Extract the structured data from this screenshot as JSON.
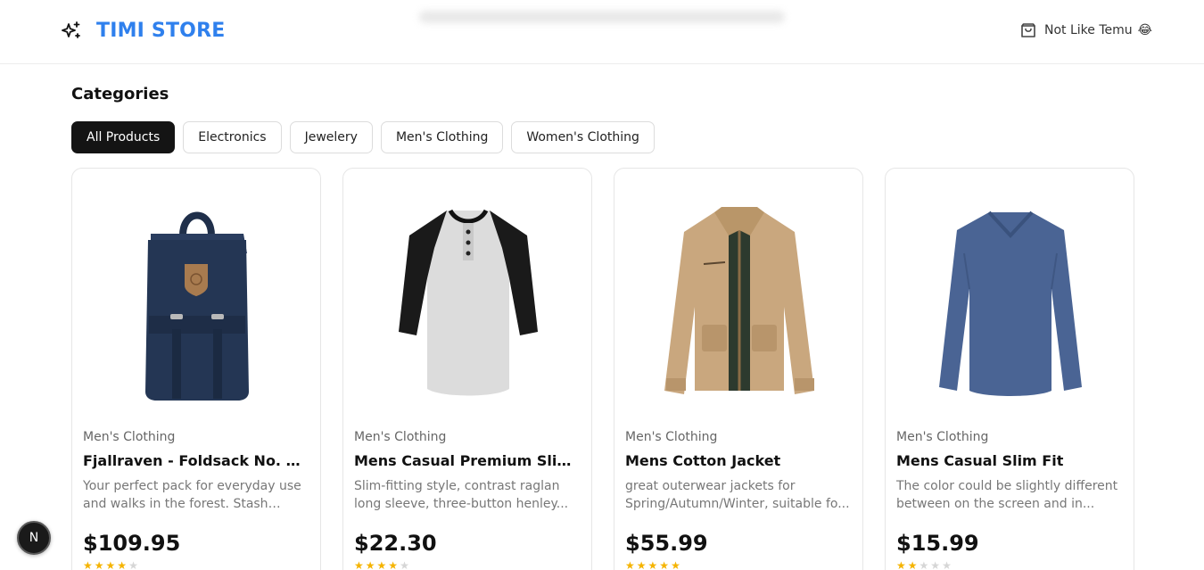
{
  "header": {
    "brand": "TIMI STORE",
    "brand_icon": "sparkles-icon",
    "cart_icon": "shopping-bag-icon",
    "tagline": "Not Like Temu",
    "tagline_emoji": "😂"
  },
  "categories": {
    "title": "Categories",
    "items": [
      {
        "label": "All Products",
        "active": true
      },
      {
        "label": "Electronics",
        "active": false
      },
      {
        "label": "Jewelery",
        "active": false
      },
      {
        "label": "Men's Clothing",
        "active": false
      },
      {
        "label": "Women's Clothing",
        "active": false
      }
    ]
  },
  "products": [
    {
      "category": "Men's Clothing",
      "title": "Fjallraven - Foldsack No. 1...",
      "description": "Your perfect pack for everyday use and walks in the forest. Stash your...",
      "price": "$109.95",
      "stars": 4,
      "image_icon": "backpack-image"
    },
    {
      "category": "Men's Clothing",
      "title": "Mens Casual Premium Slim Fi...",
      "description": "Slim-fitting style, contrast raglan long sleeve, three-button henley...",
      "price": "$22.30",
      "stars": 4,
      "image_icon": "raglan-shirt-image"
    },
    {
      "category": "Men's Clothing",
      "title": "Mens Cotton Jacket",
      "description": "great outerwear jackets for Spring/Autumn/Winter, suitable fo...",
      "price": "$55.99",
      "stars": 5,
      "image_icon": "cotton-jacket-image"
    },
    {
      "category": "Men's Clothing",
      "title": "Mens Casual Slim Fit",
      "description": "The color could be slightly different between on the screen and in...",
      "price": "$15.99",
      "stars": 2,
      "image_icon": "slim-fit-shirt-image"
    }
  ],
  "dev_badge": "N",
  "colors": {
    "brand": "#2f80ed",
    "active_chip": "#141414",
    "star": "#f5b400",
    "backpack": "#243654",
    "shirt_gray": "#dcdcdc",
    "jacket": "#c9a77e",
    "slim_shirt": "#4a6494"
  }
}
